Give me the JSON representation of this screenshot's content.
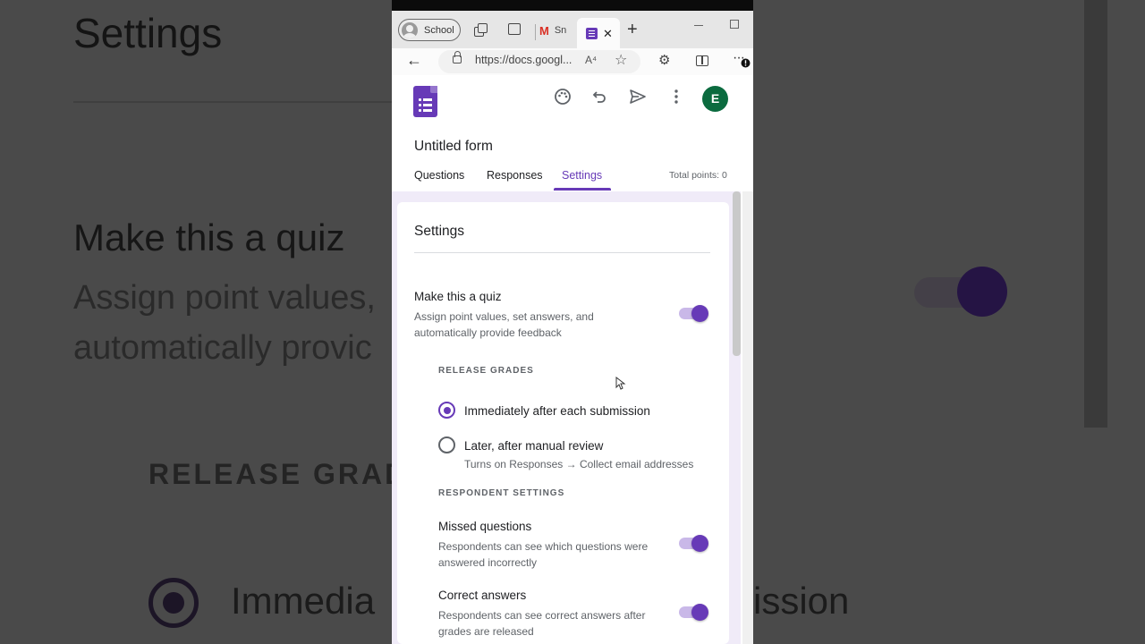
{
  "background_zoom": {
    "settings": "Settings",
    "quiz_title": "Make this a quiz",
    "assign_line": "Assign point values,",
    "auto_line": "automatically provic",
    "release": "RELEASE GRADE",
    "immediate": "Immedia",
    "tail": "ission"
  },
  "browser": {
    "profile_label": "School",
    "gmail_tab_label": "Sn",
    "url": "https://docs.googl...",
    "read_aloud": "A⁴",
    "more": "···"
  },
  "forms": {
    "form_title": "Untitled form",
    "avatar_letter": "E",
    "tabs": {
      "questions": "Questions",
      "responses": "Responses",
      "settings": "Settings"
    },
    "total_points": "Total points: 0"
  },
  "settings_card": {
    "title": "Settings",
    "quiz": {
      "title": "Make this a quiz",
      "description": "Assign point values, set answers, and automatically provide feedback",
      "enabled": true
    },
    "release_grades": {
      "label": "RELEASE GRADES",
      "options": [
        {
          "label": "Immediately after each submission",
          "selected": true
        },
        {
          "label": "Later, after manual review",
          "selected": false,
          "description": "Turns on Responses → Collect email addresses"
        }
      ]
    },
    "respondent_settings": {
      "label": "RESPONDENT SETTINGS",
      "items": [
        {
          "title": "Missed questions",
          "description": "Respondents can see which questions were answered incorrectly",
          "enabled": true
        },
        {
          "title": "Correct answers",
          "description": "Respondents can see correct answers after grades are released",
          "enabled": true
        }
      ]
    }
  },
  "colors": {
    "accent": "#673ab7",
    "accent_light": "#c9b8e8",
    "page_tint": "#f0ebf8",
    "avatar": "#0b6b3f"
  }
}
